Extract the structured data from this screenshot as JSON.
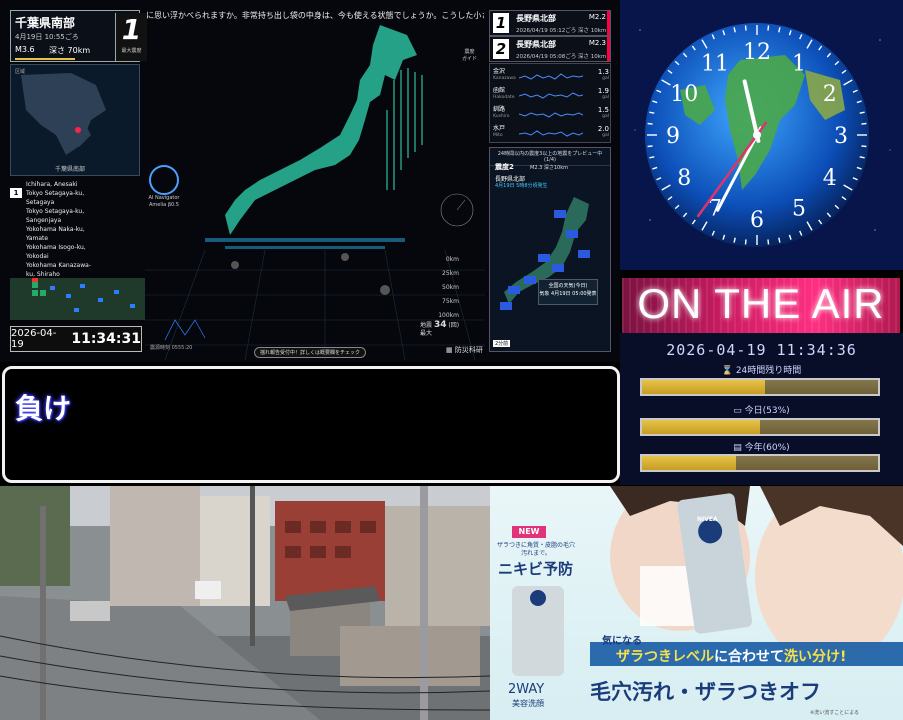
{
  "eq": {
    "ticker": "に思い浮かべられますか。非常持ち出し袋の中身は、今も使える状態でしょうか。こうした小さな確",
    "latest": {
      "region": "千葉県南部",
      "time": "4月19日 10:55ごろ",
      "magnitude": "M3.6",
      "depth": "深さ 70km",
      "intensity": "1",
      "intensity_label": "最大震度"
    },
    "minimap": {
      "corner_label": "区域",
      "label": "千葉県南部"
    },
    "affected": {
      "index": "1",
      "places": [
        "Ichihara, Anesaki",
        "Tokyo Setagaya-ku,",
        "Setagaya",
        "Tokyo Setagaya-ku,",
        "Sangenjaya",
        "Yokohama Naka-ku,",
        "Yamate",
        "Yokohama Isogo-ku,",
        "Yokodai",
        "Yokohama Kanazawa-",
        "ku, Shiraho"
      ]
    },
    "date": "2026-04-19",
    "clock": "11:34:31",
    "guide": [
      "震度",
      "ガイド"
    ],
    "ai": {
      "name": "AI Navigator",
      "model": "Amelia β0.5"
    },
    "depth_scale": [
      "0km",
      "25km",
      "50km",
      "75km",
      "100km"
    ],
    "counters": {
      "label": "地震",
      "value": "34",
      "unit": "(回)",
      "label2": "最大"
    },
    "origin": "震源時刻 0555:20",
    "check": "揺れ報告受付中！詳しくは概要欄をチェック",
    "credit": "防災科研",
    "recent": [
      {
        "n": "1",
        "region": "長野県北部",
        "mag": "M2.2",
        "time": "2026/04/19 05:12ごろ  深さ 10km"
      },
      {
        "n": "2",
        "region": "長野県北部",
        "mag": "M2.3",
        "time": "2026/04/19 05:08ごろ  深さ 10km"
      }
    ],
    "sensors": [
      {
        "name": "金沢",
        "en": "Kanazawa",
        "value": "1.3",
        "unit": "gal"
      },
      {
        "name": "函館",
        "en": "Hakodate",
        "value": "1.9",
        "unit": "gal"
      },
      {
        "name": "釧路",
        "en": "Kushiro",
        "value": "1.5",
        "unit": "gal"
      },
      {
        "name": "水戸",
        "en": "Mito",
        "value": "2.0",
        "unit": "gal"
      }
    ],
    "preview": {
      "header": "24時間以内の震度3以上の地震をプレビュー中 (1/4)",
      "title": "震度2",
      "sub": "M2.3 深さ10km",
      "region": "長野県北部",
      "time": "4月19日 5時8分頃発生",
      "weather_title": "全国の天気(今日)",
      "weather_sub": "気象 4月19日 05:00発表",
      "pager": "2分前"
    }
  },
  "clock_panel": {
    "numbers": [
      "12",
      "1",
      "2",
      "3",
      "4",
      "5",
      "6",
      "7",
      "8",
      "9",
      "10",
      "11"
    ],
    "hour": 11,
    "minute": 34,
    "second": 36
  },
  "onair": {
    "text": "ON THE AIR"
  },
  "progress": {
    "stamp": "2026-04-19 11:34:36",
    "bars": [
      {
        "label": "24時間残り時間",
        "fraction": 0.52
      },
      {
        "label": "今日(53%)",
        "fraction": 0.5
      },
      {
        "label": "今年(60%)",
        "fraction": 0.4
      }
    ]
  },
  "comment": {
    "text": "負け"
  },
  "ad": {
    "new": "NEW",
    "small": "ザラつきに角質・皮脂の毛穴汚れまで。",
    "nikibi": "ニキビ予防",
    "twoway": "2WAY",
    "beauty": "美容洗顔",
    "ki": "気になる",
    "zara_pre": "ザラつきレベル",
    "zara_mid": "に合わせて",
    "zara_post": "洗い分け!",
    "main": "毛穴汚れ・ザラつきオフ",
    "note": "※洗い流すことによる",
    "brand": "NIVEA"
  },
  "colors": {
    "accent_pink": "#ff2f82",
    "gauge_gold": "#d6ad30",
    "map_teal": "#2fd6b0",
    "ad_navy": "#1b3c7a"
  }
}
